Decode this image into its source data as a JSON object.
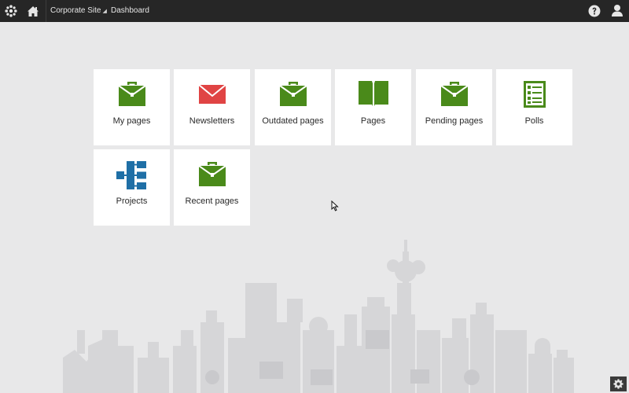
{
  "topbar": {
    "site_label": "Corporate Site",
    "breadcrumb": "Dashboard"
  },
  "tiles": [
    {
      "label": "My pages",
      "icon": "briefcase-icon",
      "color": "#4a8a1a"
    },
    {
      "label": "Newsletters",
      "icon": "envelope-icon",
      "color": "#e04444"
    },
    {
      "label": "Outdated pages",
      "icon": "briefcase-icon",
      "color": "#4a8a1a"
    },
    {
      "label": "Pages",
      "icon": "book-icon",
      "color": "#4a8a1a"
    },
    {
      "label": "Pending pages",
      "icon": "briefcase-icon",
      "color": "#4a8a1a"
    },
    {
      "label": "Polls",
      "icon": "checklist-icon",
      "color": "#4a8a1a"
    },
    {
      "label": "Projects",
      "icon": "hierarchy-icon",
      "color": "#1f6fa6"
    },
    {
      "label": "Recent pages",
      "icon": "briefcase-icon",
      "color": "#4a8a1a"
    }
  ],
  "colors": {
    "topbar_bg": "#262626",
    "page_bg": "#e8e8e9",
    "tile_bg": "#ffffff",
    "green": "#4a8a1a",
    "red": "#e04444",
    "blue": "#1f6fa6"
  }
}
